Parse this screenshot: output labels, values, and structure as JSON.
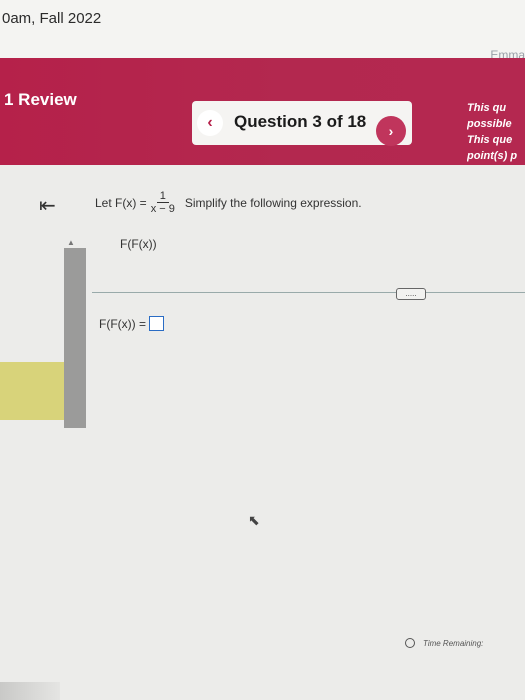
{
  "course": {
    "title": "0am, Fall 2022"
  },
  "user": {
    "name": "Emma"
  },
  "header": {
    "review_label": "1 Review",
    "question_counter": "Question 3 of 18",
    "prev_glyph": "‹",
    "next_glyph": "›",
    "side_info": [
      "This qu",
      "possible",
      "This que",
      "point(s) p"
    ]
  },
  "question": {
    "prefix": "Let F(x) =",
    "fraction": {
      "numerator": "1",
      "denominator": "x − 9"
    },
    "instruction": "Simplify the following expression.",
    "expression": "F(F(x))",
    "answer_label": "F(F(x)) =",
    "answer_value": "",
    "more_label": "....."
  },
  "footer": {
    "timer_label": "Time Remaining:"
  },
  "icons": {
    "collapse": "collapse-left-icon",
    "cursor": "mouse-pointer-icon",
    "clock": "clock-icon"
  },
  "colors": {
    "accent": "#b5214a",
    "input_border": "#2a6cc4"
  }
}
